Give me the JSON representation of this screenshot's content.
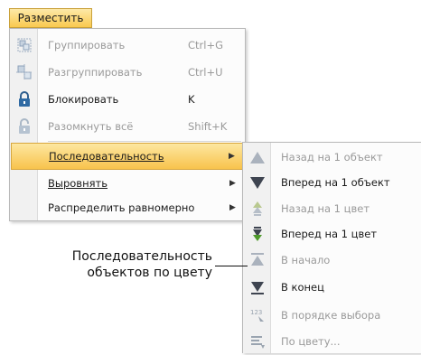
{
  "menu_button": {
    "label": "Разместить"
  },
  "main_menu": {
    "items": [
      {
        "label": "Группировать",
        "shortcut": "Ctrl+G",
        "icon": "group-icon",
        "enabled": false
      },
      {
        "label": "Разгруппировать",
        "shortcut": "Ctrl+U",
        "icon": "ungroup-icon",
        "enabled": false
      },
      {
        "label": "Блокировать",
        "shortcut": "K",
        "icon": "lock-icon",
        "enabled": true
      },
      {
        "label": "Разомкнуть всё",
        "shortcut": "Shift+K",
        "icon": "unlock-icon",
        "enabled": false
      },
      {
        "label": "Последовательность",
        "shortcut": "",
        "icon": "",
        "enabled": true,
        "submenu": true,
        "highlighted": true
      },
      {
        "label": "Выровнять",
        "shortcut": "",
        "icon": "",
        "enabled": true,
        "submenu": true
      },
      {
        "label": "Распределить равномерно",
        "shortcut": "",
        "icon": "",
        "enabled": true,
        "submenu": true
      }
    ]
  },
  "sub_menu": {
    "items": [
      {
        "label": "Назад на 1 объект",
        "icon": "move-back-one-object-icon",
        "enabled": false
      },
      {
        "label": "Вперед на 1 объект",
        "icon": "move-forward-one-object-icon",
        "enabled": true
      },
      {
        "label": "Назад на 1 цвет",
        "icon": "move-back-one-color-icon",
        "enabled": false
      },
      {
        "label": "Вперед на 1 цвет",
        "icon": "move-forward-one-color-icon",
        "enabled": true
      },
      {
        "label": "В начало",
        "icon": "move-to-start-icon",
        "enabled": false
      },
      {
        "label": "В конец",
        "icon": "move-to-end-icon",
        "enabled": true
      },
      {
        "label": "В порядке выбора",
        "icon": "selection-order-icon",
        "enabled": false
      },
      {
        "label": "По цвету...",
        "icon": "by-color-icon",
        "enabled": false
      }
    ]
  },
  "callout": {
    "line1": "Последовательность",
    "line2": "объектов по цвету"
  },
  "colors": {
    "highlight": "#f8c34c",
    "disabled_text": "#9a9a9a",
    "icon_dark": "#3e4450",
    "icon_green": "#4f9a2c"
  }
}
